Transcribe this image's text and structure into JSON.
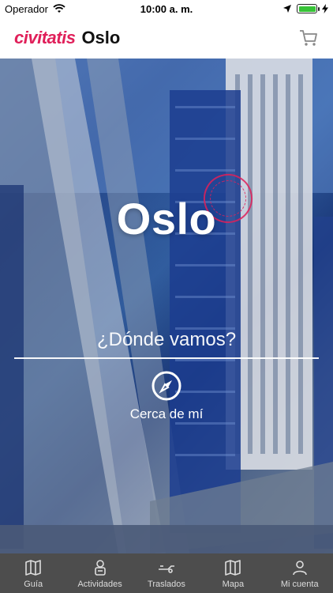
{
  "status_bar": {
    "carrier": "Operador",
    "time": "10:00 a. m."
  },
  "header": {
    "brand": "civitatis",
    "city": "Oslo"
  },
  "hero": {
    "title": "Oslo",
    "search_placeholder": "¿Dónde vamos?",
    "near_label": "Cerca de mí"
  },
  "tabs": [
    {
      "label": "Guía",
      "icon": "map-icon"
    },
    {
      "label": "Actividades",
      "icon": "person-icon"
    },
    {
      "label": "Traslados",
      "icon": "transfer-icon"
    },
    {
      "label": "Mapa",
      "icon": "map-icon"
    },
    {
      "label": "Mi cuenta",
      "icon": "user-icon"
    }
  ],
  "colors": {
    "brand": "#e0205a",
    "tabbar": "#4d4d4d"
  }
}
